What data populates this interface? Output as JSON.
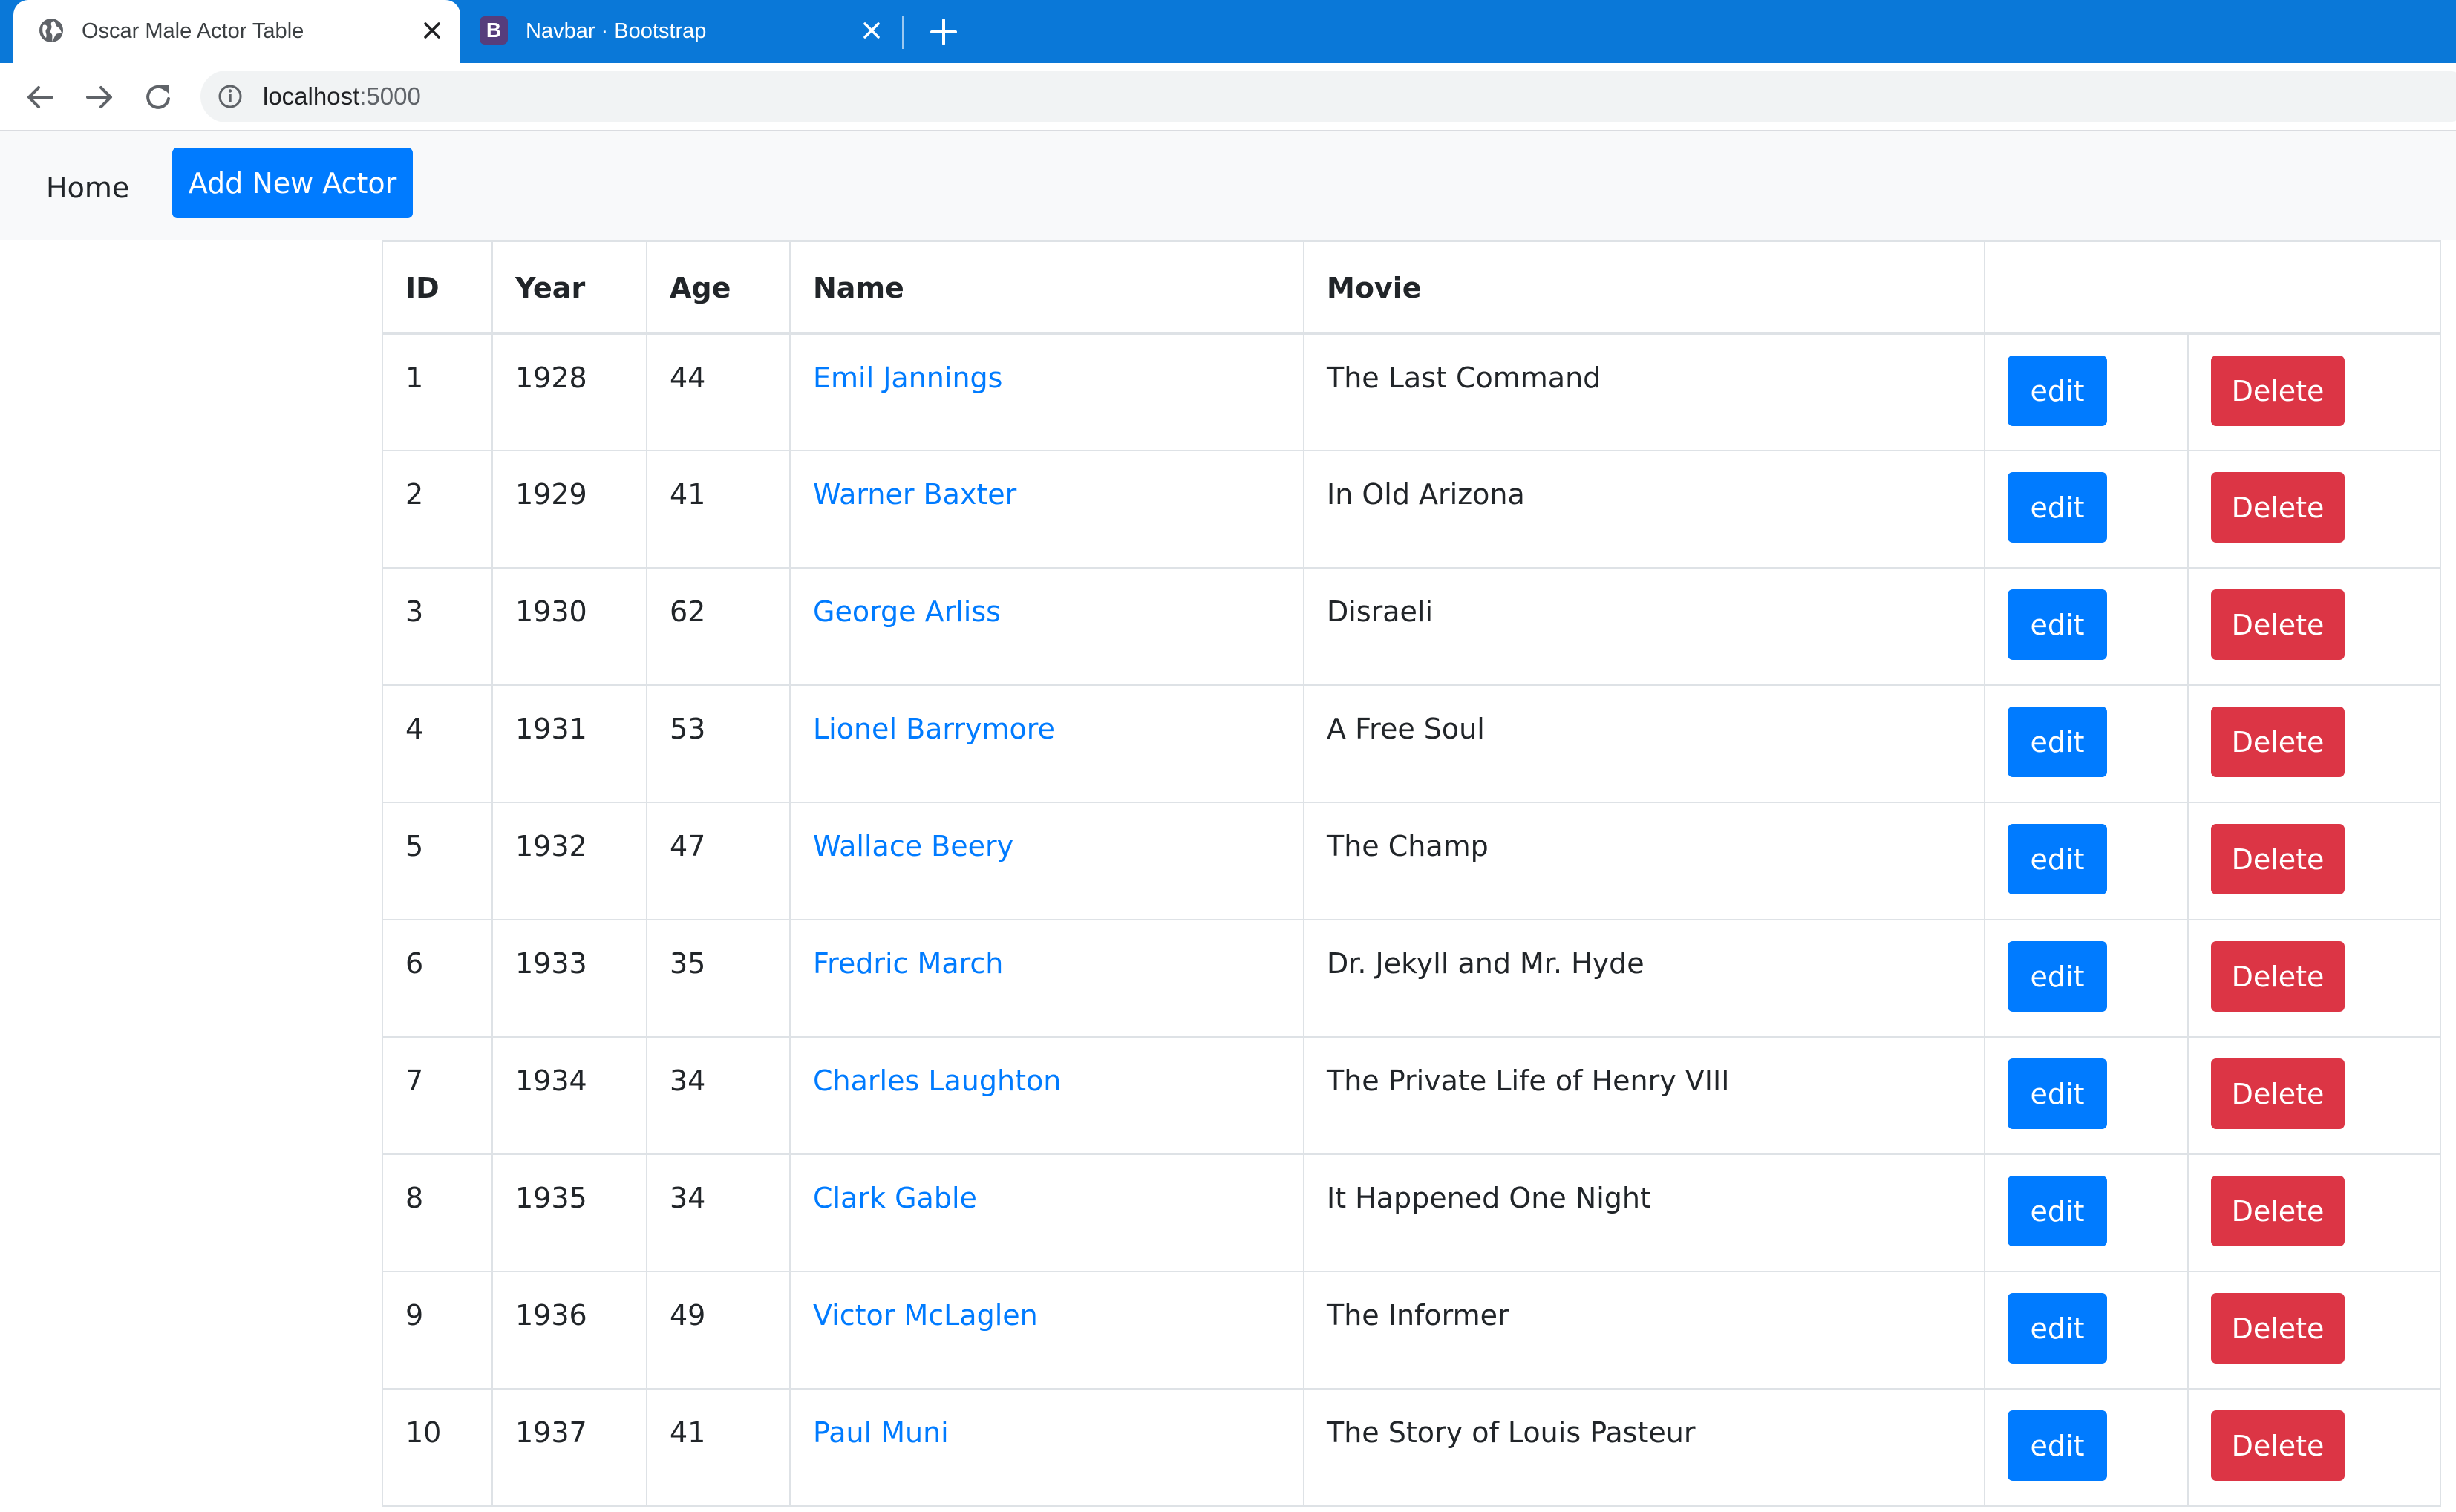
{
  "browser": {
    "tabs": [
      {
        "title": "Oscar Male Actor Table",
        "icon": "globe-icon",
        "active": true
      },
      {
        "title": "Navbar · Bootstrap",
        "icon": "bootstrap-logo-icon",
        "active": false
      }
    ],
    "bootstrap_logo_letter": "B",
    "url_host": "localhost",
    "url_port": ":5000"
  },
  "navbar": {
    "home_label": "Home",
    "add_button_label": "Add New Actor"
  },
  "table": {
    "headers": [
      "ID",
      "Year",
      "Age",
      "Name",
      "Movie",
      ""
    ],
    "rows": [
      {
        "id": "1",
        "year": "1928",
        "age": "44",
        "name": "Emil Jannings",
        "movie": "The Last Command"
      },
      {
        "id": "2",
        "year": "1929",
        "age": "41",
        "name": "Warner Baxter",
        "movie": "In Old Arizona"
      },
      {
        "id": "3",
        "year": "1930",
        "age": "62",
        "name": "George Arliss",
        "movie": "Disraeli"
      },
      {
        "id": "4",
        "year": "1931",
        "age": "53",
        "name": "Lionel Barrymore",
        "movie": "A Free Soul"
      },
      {
        "id": "5",
        "year": "1932",
        "age": "47",
        "name": "Wallace Beery",
        "movie": "The Champ"
      },
      {
        "id": "6",
        "year": "1933",
        "age": "35",
        "name": "Fredric March",
        "movie": "Dr. Jekyll and Mr. Hyde"
      },
      {
        "id": "7",
        "year": "1934",
        "age": "34",
        "name": "Charles Laughton",
        "movie": "The Private Life of Henry VIII"
      },
      {
        "id": "8",
        "year": "1935",
        "age": "34",
        "name": "Clark Gable",
        "movie": "It Happened One Night"
      },
      {
        "id": "9",
        "year": "1936",
        "age": "49",
        "name": "Victor McLaglen",
        "movie": "The Informer"
      },
      {
        "id": "10",
        "year": "1937",
        "age": "41",
        "name": "Paul Muni",
        "movie": "The Story of Louis Pasteur"
      }
    ],
    "edit_label": "edit",
    "delete_label": "Delete"
  },
  "colors": {
    "tabstrip": "#0a78d8",
    "primary": "#007bff",
    "danger": "#dc3545",
    "navbar_bg": "#f8f9fa"
  }
}
